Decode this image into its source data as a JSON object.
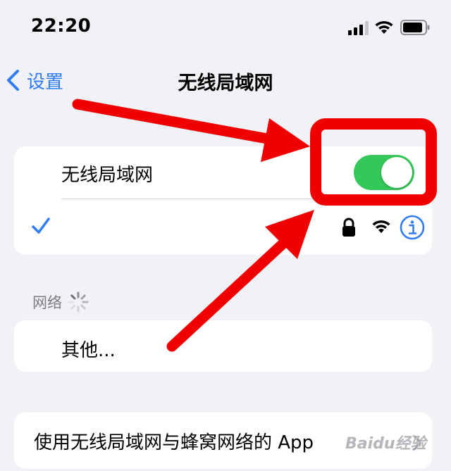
{
  "status_bar": {
    "time": "22:20",
    "icons": [
      "cellular-signal-icon",
      "wifi-icon",
      "battery-icon"
    ]
  },
  "nav": {
    "back_label": "设置",
    "title": "无线局域网"
  },
  "wifi_card": {
    "toggle_label": "无线局域网",
    "toggle_on": true,
    "connected_network": {
      "name": "",
      "icons": [
        "checkmark-icon",
        "lock-icon",
        "wifi-icon",
        "info-icon"
      ]
    }
  },
  "networks_section": {
    "header": "网络",
    "loading": true,
    "other_label": "其他..."
  },
  "apps_row": {
    "label": "使用无线局域网与蜂窝网络的 App"
  },
  "watermark": "Baidu经验",
  "colors": {
    "accent": "#2f7cf6",
    "toggle_on": "#34c759",
    "annotation_red": "#f00000",
    "background": "#f1f2f6"
  }
}
